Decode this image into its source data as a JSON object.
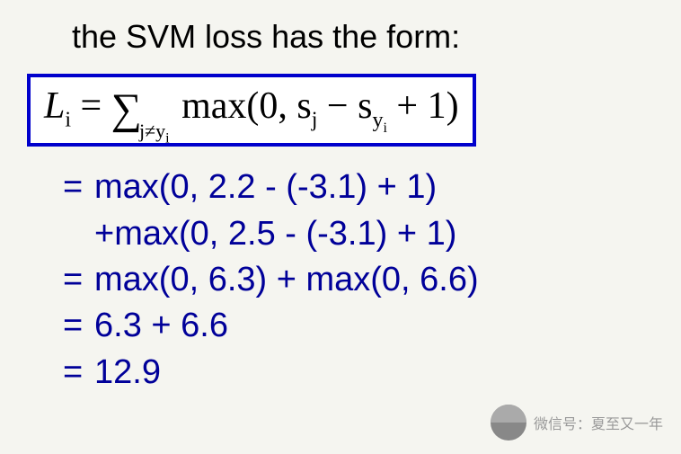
{
  "title": "the SVM loss has the form:",
  "formula": {
    "lhs": "L",
    "lhs_sub": "i",
    "op_eq": " = ",
    "sigma": "∑",
    "sigma_sub_1": "j≠y",
    "sigma_sub_2": "i",
    "fn": " max(0, s",
    "sj_sub": "j",
    "mid": " − s",
    "sy_sub_1": "y",
    "sy_sub_2": "i",
    "tail": " + 1)"
  },
  "lines": {
    "l1a_eq": "=",
    "l1a": "max(0, 2.2 - (-3.1) + 1)",
    "l1b": "+max(0, 2.5 - (-3.1) + 1)",
    "l2_eq": "=",
    "l2": "max(0, 6.3) + max(0, 6.6)",
    "l3_eq": "=",
    "l3": "6.3 + 6.6",
    "l4_eq": "=",
    "l4": "12.9"
  },
  "watermark": {
    "text": "夏至又一年"
  },
  "chart_data": {
    "type": "table",
    "description": "SVM hinge loss worked example",
    "formula": "L_i = sum_{j != y_i} max(0, s_j - s_{y_i} + 1)",
    "s_yi": -3.1,
    "s_j_values": [
      2.2,
      2.5
    ],
    "margin": 1,
    "terms": [
      6.3,
      6.6
    ],
    "result": 12.9
  }
}
